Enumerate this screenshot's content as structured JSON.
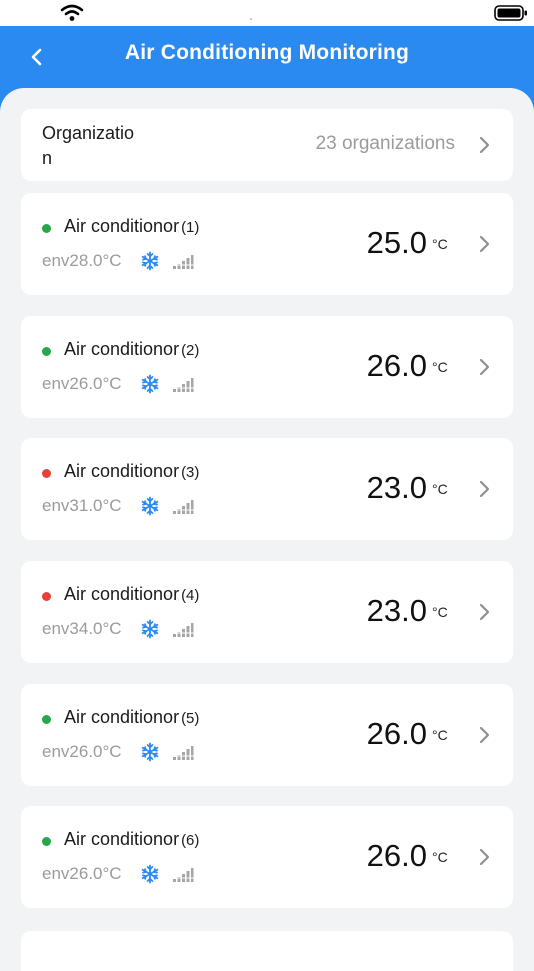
{
  "header": {
    "title": "Air Conditioning Monitoring",
    "back_icon": "chevron-left-icon"
  },
  "organization": {
    "label": "Organizatio\nn",
    "count": "23 organizations"
  },
  "colors": {
    "header_bg": "#2b8af0",
    "online": "#27a64a",
    "offline": "#e5413a",
    "snow": "#2b8af0"
  },
  "devices": [
    {
      "name": "Air conditionor",
      "index": "(1)",
      "env": "env28.0°C",
      "temp": "25.0",
      "unit": "°C",
      "status": "online",
      "mode_icon": "snowflake-icon",
      "signal_icon": "signal-icon"
    },
    {
      "name": "Air conditionor",
      "index": "(2)",
      "env": "env26.0°C",
      "temp": "26.0",
      "unit": "°C",
      "status": "online",
      "mode_icon": "snowflake-icon",
      "signal_icon": "signal-icon"
    },
    {
      "name": "Air conditionor",
      "index": "(3)",
      "env": "env31.0°C",
      "temp": "23.0",
      "unit": "°C",
      "status": "offline",
      "mode_icon": "snowflake-icon",
      "signal_icon": "signal-icon"
    },
    {
      "name": "Air conditionor",
      "index": "(4)",
      "env": "env34.0°C",
      "temp": "23.0",
      "unit": "°C",
      "status": "offline",
      "mode_icon": "snowflake-icon",
      "signal_icon": "signal-icon"
    },
    {
      "name": "Air conditionor",
      "index": "(5)",
      "env": "env26.0°C",
      "temp": "26.0",
      "unit": "°C",
      "status": "online",
      "mode_icon": "snowflake-icon",
      "signal_icon": "signal-icon"
    },
    {
      "name": "Air conditionor",
      "index": "(6)",
      "env": "env26.0°C",
      "temp": "26.0",
      "unit": "°C",
      "status": "online",
      "mode_icon": "snowflake-icon",
      "signal_icon": "signal-icon"
    }
  ]
}
